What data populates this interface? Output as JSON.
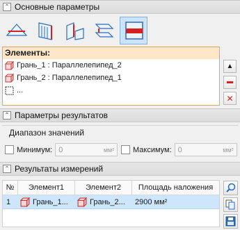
{
  "main_params": {
    "title": "Основные параметры"
  },
  "toolbar": {
    "buttons": [
      {
        "icon": "shape-edge-icon"
      },
      {
        "icon": "shape-face-icon"
      },
      {
        "icon": "shape-angle-icon"
      },
      {
        "icon": "shape-parallel-planes-icon"
      },
      {
        "icon": "overlap-area-icon",
        "active": true
      }
    ]
  },
  "elements": {
    "label": "Элементы:",
    "items": [
      {
        "text": "Грань_1 : Параллелепипед_2"
      },
      {
        "text": "Грань_2 : Параллелепипед_1"
      },
      {
        "text": "..."
      }
    ]
  },
  "result_params": {
    "title": "Параметры результатов",
    "range_title": "Диапазон значений",
    "min_label": "Минимум:",
    "min_value": "0",
    "max_label": "Максимум:",
    "max_value": "0",
    "unit": "мм²"
  },
  "measurements": {
    "title": "Результаты измерений",
    "columns": [
      "№",
      "Элемент1",
      "Элемент2",
      "Площадь наложения"
    ],
    "rows": [
      {
        "num": "1",
        "el1": "Грань_1...",
        "el2": "Грань_2...",
        "area": "2900 мм²"
      }
    ]
  },
  "colors": {
    "accent_orange": "#fde7c8",
    "selection_blue": "#cde6fb",
    "delete_red": "#d62020"
  }
}
